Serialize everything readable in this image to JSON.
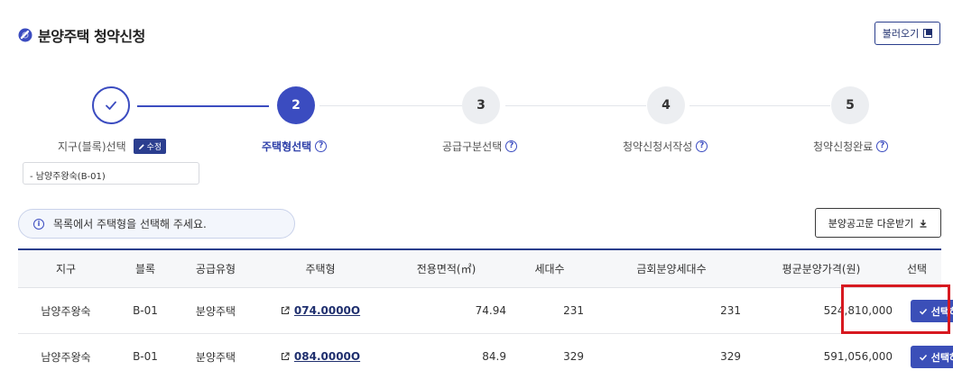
{
  "header": {
    "title": "분양주택 청약신청",
    "load_button": "불러오기"
  },
  "stepper": {
    "steps": [
      {
        "number": "1",
        "label": "지구(블록)선택",
        "state": "done",
        "edit_badge": "수정"
      },
      {
        "number": "2",
        "label": "주택형선택",
        "state": "active"
      },
      {
        "number": "3",
        "label": "공급구분선택",
        "state": "todo"
      },
      {
        "number": "4",
        "label": "청약신청서작성",
        "state": "todo"
      },
      {
        "number": "5",
        "label": "청약신청완료",
        "state": "todo"
      }
    ],
    "selected_district": "- 남양주왕숙(B-01)"
  },
  "info": {
    "message": "목록에서 주택형을 선택해 주세요.",
    "icon": "info-icon"
  },
  "download_button": "분양공고문 다운받기",
  "table": {
    "headers": [
      "지구",
      "블록",
      "공급유형",
      "주택형",
      "전용면적(㎡)",
      "세대수",
      "금회분양세대수",
      "평균분양가격(원)",
      "선택"
    ],
    "rows": [
      {
        "district": "남양주왕숙",
        "block": "B-01",
        "type": "분양주택",
        "house": "074.0000O",
        "area": "74.94",
        "units": "231",
        "current_units": "231",
        "price": "524,810,000",
        "action": "선택하기"
      },
      {
        "district": "남양주왕숙",
        "block": "B-01",
        "type": "분양주택",
        "house": "084.0000O",
        "area": "84.9",
        "units": "329",
        "current_units": "329",
        "price": "591,056,000",
        "action": "선택하기"
      }
    ]
  },
  "colors": {
    "primary": "#3b4cc0",
    "navy": "#2a3e8c",
    "highlight": "#d71920"
  }
}
